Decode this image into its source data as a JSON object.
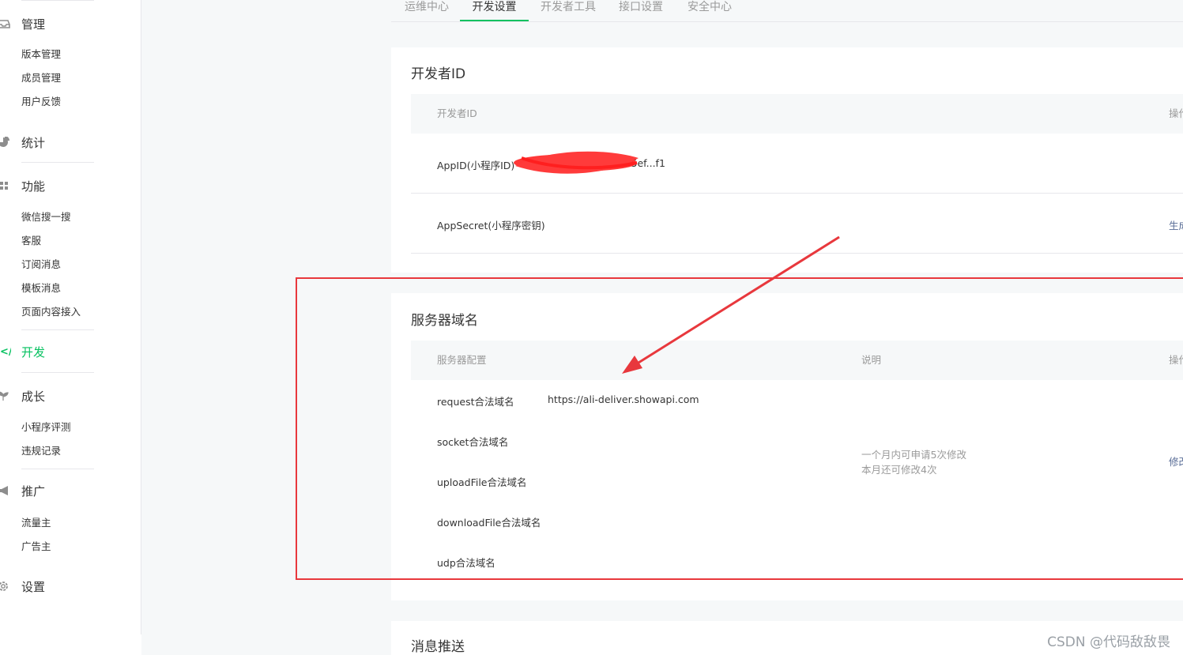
{
  "sidebar": {
    "groups": [
      {
        "label": "管理",
        "icon": "inbox-icon",
        "items": [
          "版本管理",
          "成员管理",
          "用户反馈"
        ]
      },
      {
        "label": "统计",
        "icon": "pie-chart-icon",
        "items": []
      },
      {
        "label": "功能",
        "icon": "grid-icon",
        "items": [
          "微信搜一搜",
          "客服",
          "订阅消息",
          "模板消息",
          "页面内容接入"
        ]
      },
      {
        "label": "开发",
        "icon": "code-icon",
        "items": [],
        "active": true
      },
      {
        "label": "成长",
        "icon": "sprout-icon",
        "items": [
          "小程序评测",
          "违规记录"
        ]
      },
      {
        "label": "推广",
        "icon": "megaphone-icon",
        "items": [
          "流量主",
          "广告主"
        ]
      },
      {
        "label": "设置",
        "icon": "gear-icon",
        "items": []
      }
    ]
  },
  "tabs": [
    "运维中心",
    "开发设置",
    "开发者工具",
    "接口设置",
    "安全中心"
  ],
  "active_tab": "开发设置",
  "developer_id": {
    "title": "开发者ID",
    "header": {
      "col1": "开发者ID",
      "col_action": "操作"
    },
    "rows": [
      {
        "label": "AppID(小程序ID)",
        "value": "wx...7fdd4c545ef...f1"
      },
      {
        "label": "AppSecret(小程序密钥)",
        "action": "生成"
      }
    ]
  },
  "server_domain": {
    "title": "服务器域名",
    "header": {
      "col1": "服务器配置",
      "col2": "说明",
      "col_action": "操作"
    },
    "rows": [
      {
        "label": "request合法域名",
        "value": "https://ali-deliver.showapi.com"
      },
      {
        "label": "socket合法域名",
        "value": ""
      },
      {
        "label": "uploadFile合法域名",
        "value": ""
      },
      {
        "label": "downloadFile合法域名",
        "value": ""
      },
      {
        "label": "udp合法域名",
        "value": ""
      }
    ],
    "note_line1": "一个月内可申请5次修改",
    "note_line2": "本月还可修改4次",
    "action": "修改"
  },
  "message_push": {
    "title": "消息推送"
  },
  "watermark": "CSDN @代码敌敌畏",
  "colors": {
    "accent": "#07c160",
    "link": "#576b95",
    "annotation": "#e8383d"
  }
}
